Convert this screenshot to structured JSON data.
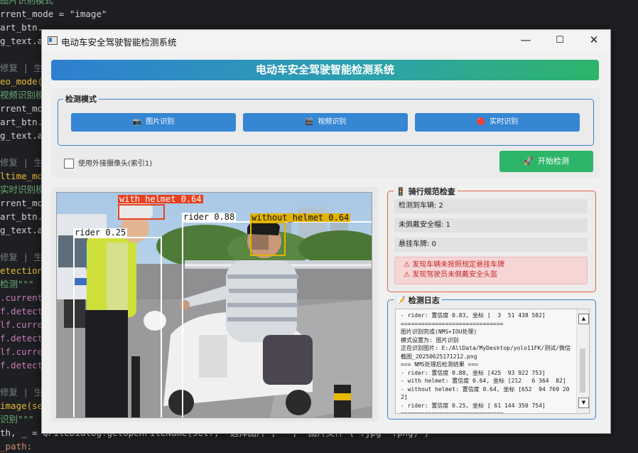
{
  "editor": {
    "lines": [
      {
        "t": "图片识别模式\"\"\"",
        "c": "c-str"
      },
      {
        "t": "rrent_mode = \"image\"",
        "c": ""
      },
      {
        "t": "art_btn.",
        "c": ""
      },
      {
        "t": "g_text.a",
        "c": ""
      },
      {
        "t": "",
        "c": ""
      },
      {
        "t": "修复 | 生成",
        "c": "c-com"
      },
      {
        "t": "eo_mode(",
        "c": "c-yel"
      },
      {
        "t": "视频识别模",
        "c": "c-str"
      },
      {
        "t": "rrent_mo",
        "c": ""
      },
      {
        "t": "art_btn.",
        "c": ""
      },
      {
        "t": "g_text.a",
        "c": ""
      },
      {
        "t": "",
        "c": ""
      },
      {
        "t": "修复 | 生成",
        "c": "c-com"
      },
      {
        "t": "ltime_mo",
        "c": "c-yel"
      },
      {
        "t": "实时识别模",
        "c": "c-str"
      },
      {
        "t": "rrent_mo",
        "c": ""
      },
      {
        "t": "art_btn.",
        "c": ""
      },
      {
        "t": "g_text.a",
        "c": ""
      },
      {
        "t": "",
        "c": ""
      },
      {
        "t": "修复 | 生成",
        "c": "c-com"
      },
      {
        "t": "etection",
        "c": "c-yel"
      },
      {
        "t": "检测\"\"\"",
        "c": "c-str"
      },
      {
        "t": ".current",
        "c": "c-pur"
      },
      {
        "t": "f.detect",
        "c": "c-pur"
      },
      {
        "t": "lf.curre",
        "c": "c-pur"
      },
      {
        "t": "f.detect",
        "c": "c-pur"
      },
      {
        "t": "lf.curre",
        "c": "c-pur"
      },
      {
        "t": "f.detect",
        "c": "c-pur"
      },
      {
        "t": "",
        "c": ""
      },
      {
        "t": "修复 | 生成",
        "c": "c-com"
      },
      {
        "t": "image(se",
        "c": "c-yel"
      },
      {
        "t": "识别\"\"\"",
        "c": "c-str"
      },
      {
        "t": "th, _ = QFileDialog.getOpenFileName(self, \"选择图片\", \"\", \"图片文件 (*.jpg *.png)\")",
        "c": ""
      },
      {
        "t": "_path:",
        "c": "c-kw"
      }
    ]
  },
  "window": {
    "title": "电动车安全驾驶智能检测系统",
    "controls": {
      "minimize": "—",
      "maximize": "☐",
      "close": "✕"
    }
  },
  "banner": {
    "title": "电动车安全驾驶智能检测系统"
  },
  "mode_group": {
    "title": "检测模式",
    "buttons": [
      {
        "icon": "📷",
        "label": "图片识别"
      },
      {
        "icon": "🎬",
        "label": "视频识别"
      },
      {
        "icon": "🔴",
        "label": "实时识别"
      }
    ]
  },
  "camera_checkbox": {
    "label": "使用外接摄像头(索引1)",
    "checked": false
  },
  "start_button": {
    "icon": "🚀",
    "label": "开始检测"
  },
  "detections": [
    {
      "label": "with_helmet 0.64"
    },
    {
      "label": "rider 0.88"
    },
    {
      "label": "without_helmet 0.64"
    },
    {
      "label": "rider 0.25"
    }
  ],
  "violation_panel": {
    "icon": "🚦",
    "title": "骑行规范检查",
    "stats": [
      {
        "label": "检测到车辆: 2"
      },
      {
        "label": "未佩戴安全帽: 1"
      },
      {
        "label": "悬挂车牌: 0"
      }
    ],
    "alerts": [
      "⚠ 发现车辆未按照规定悬挂车牌",
      "⚠ 发现驾驶员未佩戴安全头盔"
    ]
  },
  "log_panel": {
    "icon": "📝",
    "title": "检测日志",
    "text": "- rider: 置信度 0.83, 坐标 [  3  51 438 582]\n==============================\n图片识别完成(NMS+IOU处理)\n模式设置为: 图片识别\n正在识别图片: E:/AllData/MyDesktop/yolo11FK/测试/微信截图_20250625171212.png\n=== NMS处理后检测结果 ===\n- rider: 置信度 0.88, 坐标 [425  93 922 753]\n- with helmet: 置信度 0.64, 坐标 [212   6 364  82]\n- without helmet: 置信度 0.64, 坐标 [652  94 769 202]\n- rider: 置信度 0.25, 坐标 [ 61 144 350 754]\n==============================",
    "scroll_up": "▲",
    "scroll_down": "▼"
  },
  "colors": {
    "accent_blue": "#3586d3",
    "start_green": "#2db56a",
    "alert_red": "#c62828",
    "box_red": "#e8401f",
    "box_yellow": "#e2b400",
    "box_white": "#ffffff"
  }
}
